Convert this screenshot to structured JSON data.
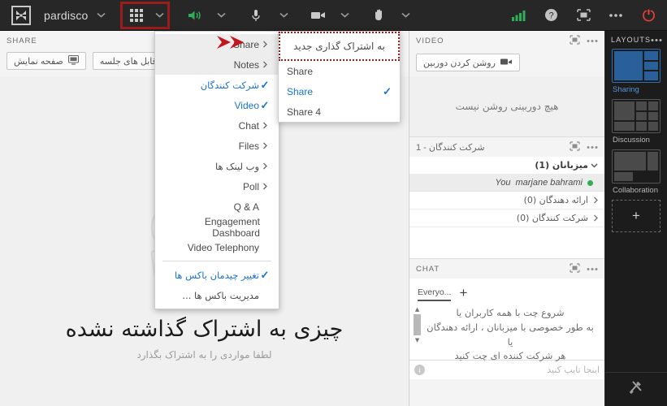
{
  "toolbar": {
    "room_name": "pardisco",
    "logo_icon": "connect-logo-icon",
    "room_chevron_icon": "chevron-down-icon",
    "pods_grid_icon": "pods-grid-icon",
    "pods_chevron_icon": "chevron-down-icon",
    "speaker_icon": "speaker-on-icon",
    "speaker_chevron_icon": "chevron-down-icon",
    "mic_icon": "microphone-icon",
    "mic_chevron_icon": "chevron-down-icon",
    "camera_icon": "camera-icon",
    "camera_chevron_icon": "chevron-down-icon",
    "hand_icon": "raise-hand-icon",
    "hand_chevron_icon": "chevron-down-icon",
    "connection_icon": "connection-strength-icon",
    "help_icon": "help-question-icon",
    "fullscreen_icon": "fullscreen-icon",
    "more_icon": "more-options-icon",
    "power_icon": "end-session-icon",
    "accent_green": "#2fae57",
    "accent_red": "#e8403a",
    "highlight_red": "#9b1c1c"
  },
  "share_pod": {
    "title": "SHARE",
    "buttons": [
      {
        "label": "صفحه نمایش",
        "icon": "screen-share-icon"
      },
      {
        "label": "قابل های جلسه",
        "icon": "document-icon"
      }
    ],
    "empty_title": "چیزی به اشتراک گذاشته نشده",
    "empty_sub": "لطفا مواردی را به اشتراک بگذارد",
    "illustration_icon": "share-placeholder-illustration"
  },
  "pod_menu": {
    "items": [
      {
        "label": "Share",
        "mark": "arrow",
        "highlight": true,
        "rtl": false
      },
      {
        "label": "Notes",
        "mark": "arrow",
        "highlight": true,
        "rtl": false
      },
      {
        "label": "شرکت کنندگان",
        "mark": "check",
        "checked": true,
        "rtl": true
      },
      {
        "label": "Video",
        "mark": "check",
        "checked": true,
        "rtl": false
      },
      {
        "label": "Chat",
        "mark": "arrow",
        "rtl": false
      },
      {
        "label": "Files",
        "mark": "arrow",
        "rtl": false
      },
      {
        "label": "وب لینک ها",
        "mark": "arrow",
        "rtl": true
      },
      {
        "label": "Poll",
        "mark": "arrow",
        "rtl": false
      },
      {
        "label": "Q & A",
        "mark": "none",
        "rtl": false
      },
      {
        "label": "Engagement Dashboard",
        "mark": "none",
        "rtl": false
      },
      {
        "label": "Video Telephony",
        "mark": "none",
        "rtl": false
      },
      {
        "separator": true
      },
      {
        "label": "تغییر چیدمان باکس ها",
        "mark": "check",
        "checked": true,
        "rtl": true
      },
      {
        "label": "مدیریت باکس ها ...",
        "mark": "none",
        "rtl": true
      }
    ]
  },
  "submenu": {
    "header": "به اشتراک گذاری جدید",
    "items": [
      {
        "label": "Share",
        "checked": false
      },
      {
        "label": "Share",
        "checked": true
      },
      {
        "label": "Share 4",
        "checked": false
      }
    ],
    "check_icon": "checkmark-icon"
  },
  "video_pod": {
    "title": "VIDEO",
    "camera_button": "روشن کردن دوربین",
    "camera_button_icon": "camera-icon",
    "empty_message": "هیچ دوربینی روشن نیست",
    "fullscreen_icon": "fullscreen-icon",
    "more_icon": "more-options-icon"
  },
  "participants_pod": {
    "title": "شرکت کنندگان - 1",
    "fullscreen_icon": "fullscreen-icon",
    "more_icon": "more-options-icon",
    "groups": [
      {
        "label": "میزبانان (1)",
        "expanded": true,
        "icon": "chevron-down-icon"
      },
      {
        "label": "ارائه دهندگان (0)",
        "expanded": false,
        "icon": "chevron-right-icon"
      },
      {
        "label": "شرکت کنندگان (0)",
        "expanded": false,
        "icon": "chevron-right-icon"
      }
    ],
    "users": [
      {
        "name": "marjane bahrami",
        "suffix": "You",
        "status_color": "#2fae57",
        "status_icon": "online-dot-icon"
      }
    ]
  },
  "chat_pod": {
    "title": "CHAT",
    "fullscreen_icon": "fullscreen-icon",
    "more_icon": "more-options-icon",
    "tab": "Everyo...",
    "add_tab_icon": "plus-icon",
    "message_lines": [
      "شروع چت با همه کاربران یا",
      "به طور خصوصی با میزبانان ، ارائه دهندگان یا",
      "هر شرکت کننده ای چت کنید"
    ],
    "input_placeholder": "اینجا تایپ کنید",
    "info_icon": "info-icon",
    "scroll_up_icon": "scroll-up-icon",
    "scroll_down_icon": "scroll-down-icon"
  },
  "layouts": {
    "title": "LAYOUTS",
    "more_icon": "more-options-icon",
    "items": [
      {
        "label": "Sharing",
        "selected": true
      },
      {
        "label": "Discussion",
        "selected": false
      },
      {
        "label": "Collaboration",
        "selected": false
      }
    ],
    "add_icon": "plus-icon",
    "tools_icon": "preferences-tools-icon",
    "selected_color": "#5596d8"
  }
}
